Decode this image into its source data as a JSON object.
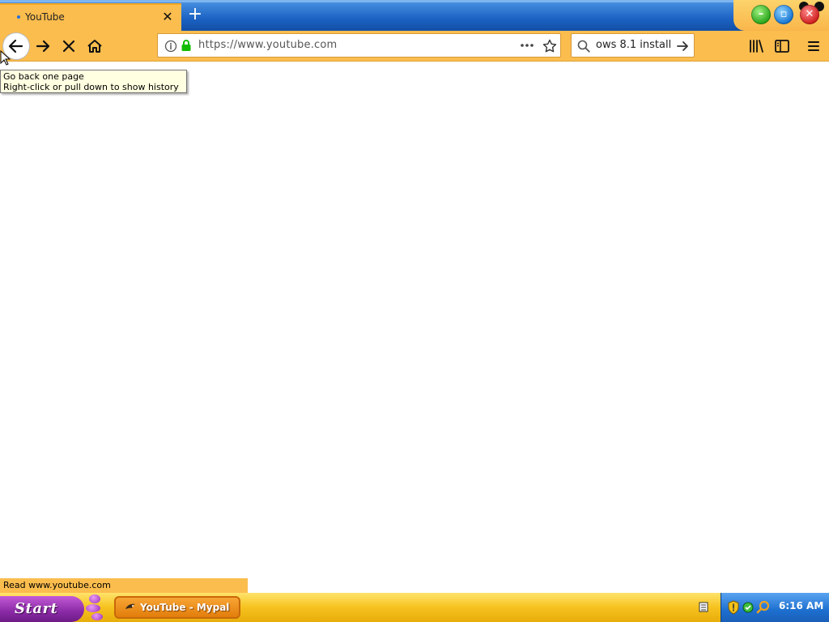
{
  "window": {
    "title": "YouTube - Mypal"
  },
  "tab": {
    "title": "YouTube"
  },
  "toolbar": {
    "url": "https://www.youtube.com",
    "search_text": "ows 8.1 install"
  },
  "tooltip": {
    "line1": "Go back one page",
    "line2": "Right-click or pull down to show history"
  },
  "status": {
    "text": "Read www.youtube.com"
  },
  "taskbar": {
    "start_label": "Start",
    "items": [
      {
        "label": "YouTube - Mypal"
      }
    ],
    "clock": "6:16 AM"
  },
  "colors": {
    "toolbar": "#fbbd4e",
    "tabstrip": "#1c63c4",
    "start": "#8a2aa5",
    "taskbar": "#f6c21f",
    "tray": "#1d6fd0"
  },
  "icons": [
    "back-icon",
    "forward-icon",
    "stop-icon",
    "home-icon",
    "info-icon",
    "lock-icon",
    "page-actions-icon",
    "bookmark-star-icon",
    "search-icon",
    "search-go-icon",
    "library-icon",
    "sidebar-icon",
    "menu-icon"
  ]
}
